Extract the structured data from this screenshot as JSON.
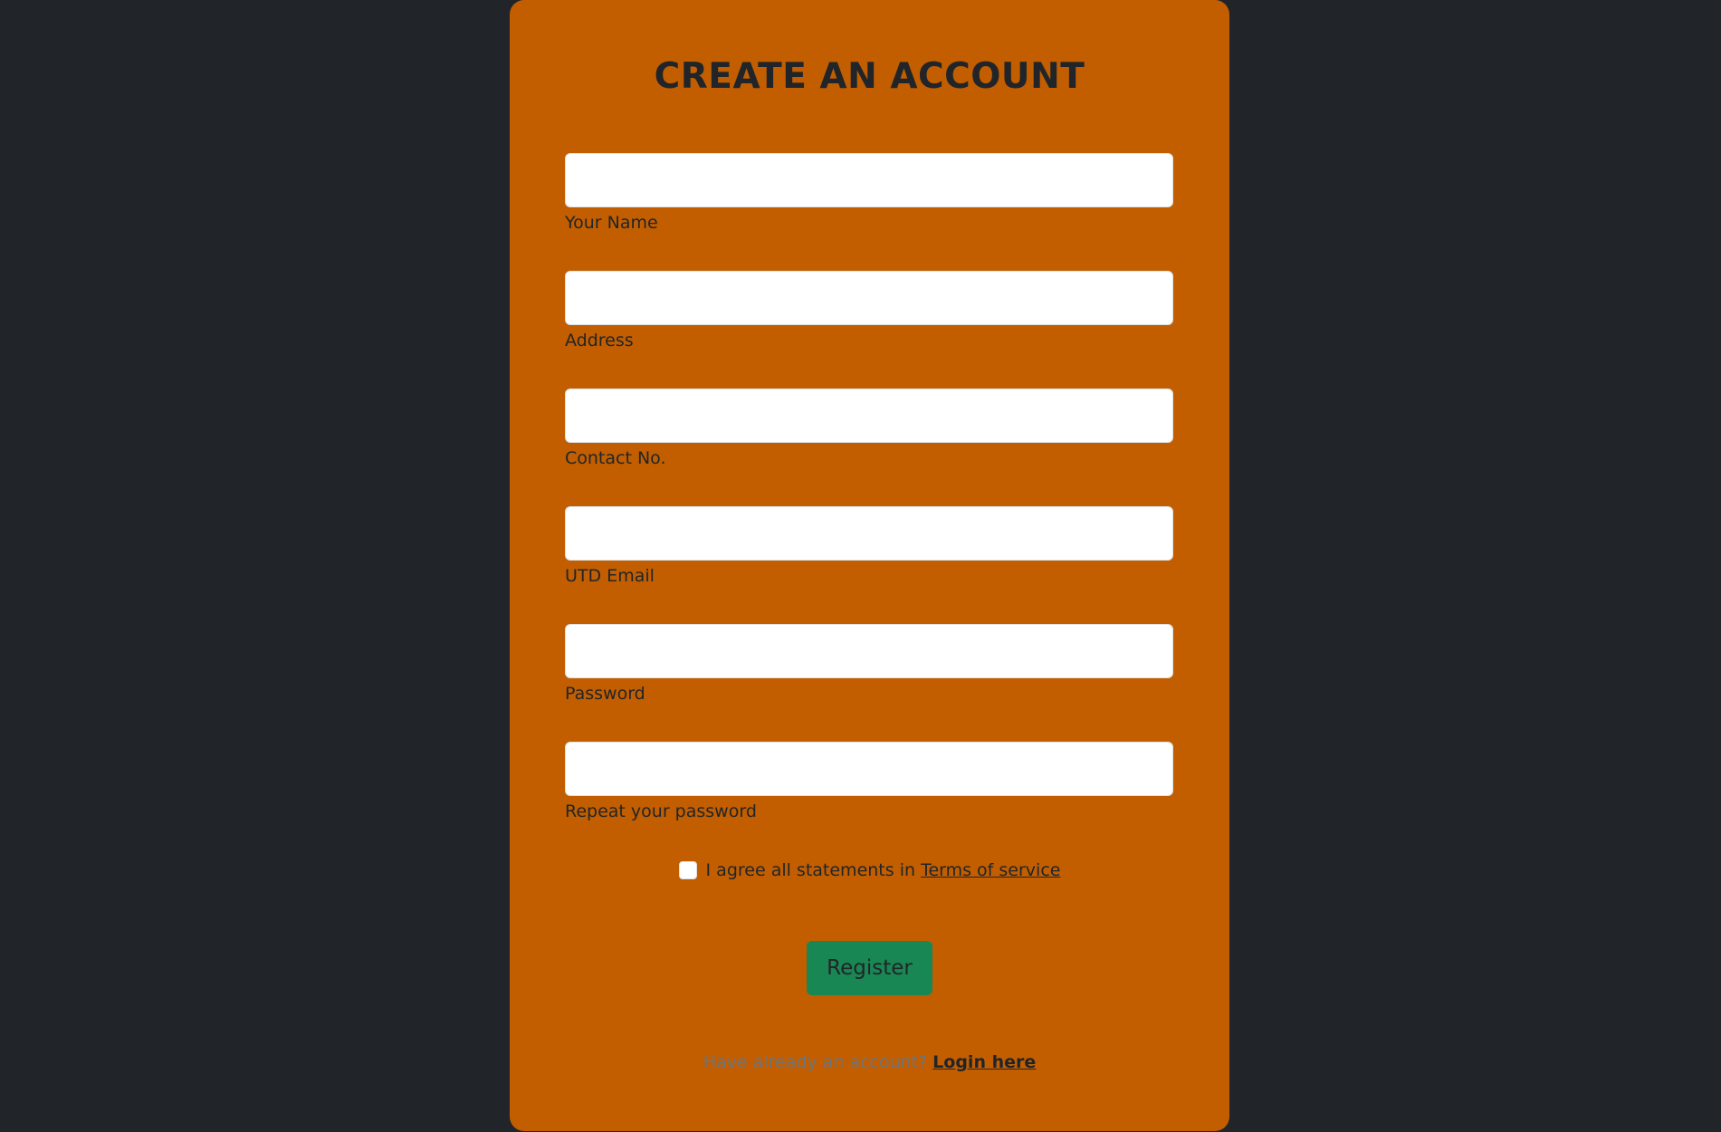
{
  "form": {
    "title": "CREATE AN ACCOUNT",
    "fields": [
      {
        "label": "Your Name",
        "value": ""
      },
      {
        "label": "Address",
        "value": ""
      },
      {
        "label": "Contact No.",
        "value": ""
      },
      {
        "label": "UTD Email",
        "value": ""
      },
      {
        "label": "Password",
        "value": ""
      },
      {
        "label": "Repeat your password",
        "value": ""
      }
    ],
    "terms_text": "I agree all statements in ",
    "terms_link": "Terms of service",
    "register_label": "Register",
    "login_prompt": "Have already an account? ",
    "login_link": "Login here"
  },
  "colors": {
    "page_background": "#212529",
    "card_background": "#c25e00",
    "register_button": "#198754"
  }
}
